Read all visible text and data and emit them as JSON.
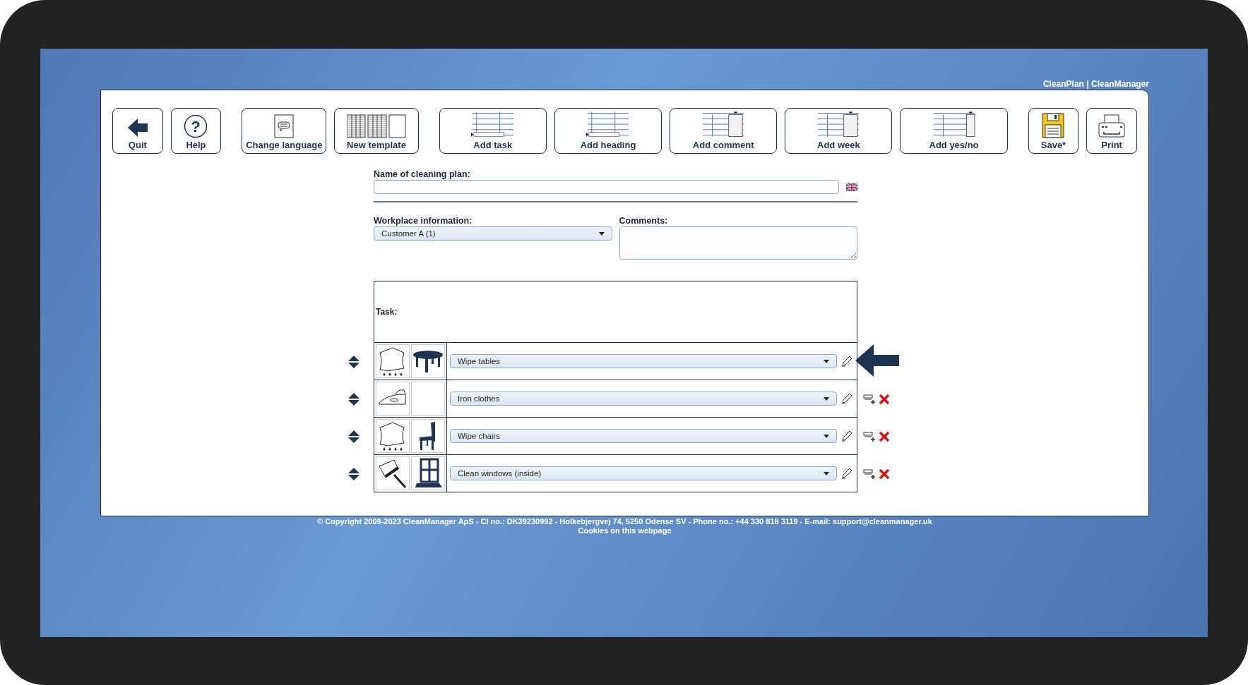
{
  "header": {
    "brand": "CleanPlan | CleanManager"
  },
  "toolbar": [
    {
      "label": "Quit",
      "kind": "quit"
    },
    {
      "label": "Help",
      "kind": "help",
      "glyph": "?"
    },
    {
      "label": "Change language",
      "kind": "language"
    },
    {
      "label": "New template",
      "kind": "template"
    },
    {
      "label": "Add task",
      "kind": "add-task"
    },
    {
      "label": "Add heading",
      "kind": "add-heading"
    },
    {
      "label": "Add comment",
      "kind": "add-comment"
    },
    {
      "label": "Add week",
      "kind": "add-week"
    },
    {
      "label": "Add yes/no",
      "kind": "add-yesno"
    },
    {
      "label": "Save*",
      "kind": "save"
    },
    {
      "label": "Print",
      "kind": "print"
    }
  ],
  "form": {
    "name_label": "Name of cleaning plan:",
    "workplace_label": "Workplace information:",
    "workplace_value": "Customer A (1)",
    "comments_label": "Comments:"
  },
  "task_table": {
    "heading": "Task:",
    "rows": [
      {
        "task": "Wipe tables",
        "actions_visible": false,
        "pictograms": [
          {
            "kind": "cloth"
          },
          {
            "kind": "table"
          }
        ]
      },
      {
        "task": "Iron clothes",
        "actions_visible": true,
        "pictograms": [
          {
            "kind": "iron"
          },
          {
            "kind": "empty"
          }
        ]
      },
      {
        "task": "Wipe chairs",
        "actions_visible": true,
        "pictograms": [
          {
            "kind": "cloth"
          },
          {
            "kind": "chair"
          }
        ]
      },
      {
        "task": "Clean windows (inside)",
        "actions_visible": true,
        "pictograms": [
          {
            "kind": "squeegee"
          },
          {
            "kind": "window"
          }
        ]
      }
    ]
  },
  "footer": {
    "copyright": "© Copyright 2009-2023 CleanManager ApS - CI no.: DK39230992 - Holkebjergvej 74, 5250 Odense SV - Phone no.: +44 330 818 3119 - E-mail: support@cleanmanager.uk",
    "cookies": "Cookies on this webpage"
  }
}
